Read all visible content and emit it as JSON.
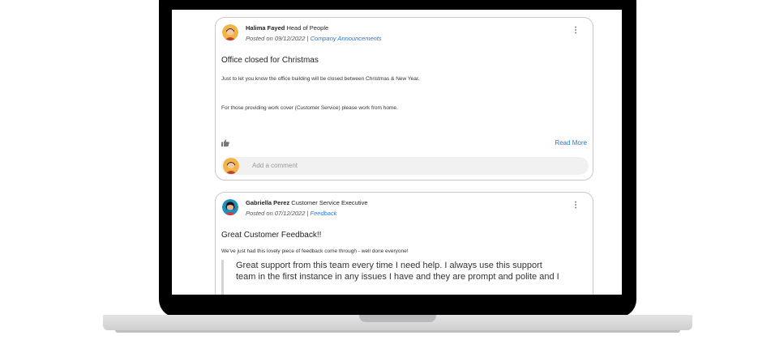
{
  "posts": [
    {
      "author_name": "Halima Fayed",
      "author_role": "Head of People",
      "posted_prefix": "Posted on 09/12/2022 |",
      "category": "Company Announcements",
      "title": "Office closed for Christmas",
      "body_line_1": "Just to let you know the office building will be closed between Christmas & New Year.",
      "body_line_2": "For those providing work cover (Customer Service) please work from home.",
      "read_more": "Read More",
      "comment_placeholder": "Add a comment"
    },
    {
      "author_name": "Gabriella Perez",
      "author_role": "Customer Service Executive",
      "posted_prefix": "Posted on 07/12/2022 |",
      "category": "Feedback",
      "title": "Great Customer Feedback!!",
      "body_line_1": "We've just had this lovely piece of feedback come through - well done everyone!",
      "quote_line_1": "Great support from this team every time I need help. I always use this support",
      "quote_line_2": "team in the first instance in any issues I have and they are prompt and polite and I"
    }
  ],
  "colors": {
    "accent": "#2a78c7",
    "avatar_1": "#f2b445",
    "avatar_2": "#1e8fbf"
  },
  "icons": {
    "menu": "kebab-menu-icon",
    "like": "thumbs-up-icon"
  }
}
